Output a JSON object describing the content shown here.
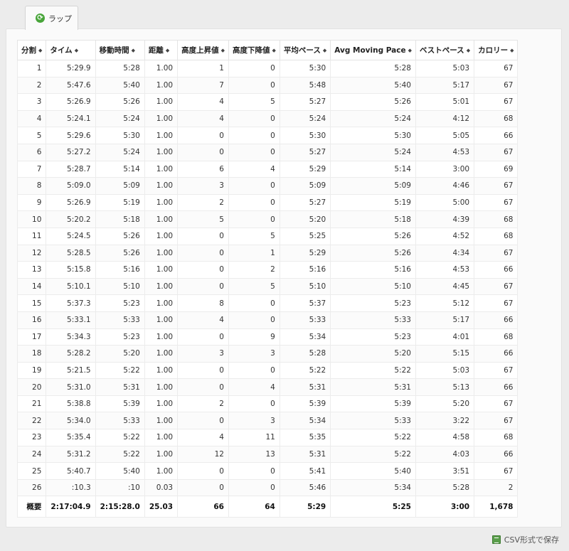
{
  "tab": {
    "label": "ラップ",
    "icon": "refresh-icon"
  },
  "columns": [
    "分割",
    "タイム",
    "移動時間",
    "距離",
    "高度上昇値",
    "高度下降値",
    "平均ペース",
    "Avg Moving Pace",
    "ベストペース",
    "カロリー"
  ],
  "rows": [
    [
      "1",
      "5:29.9",
      "5:28",
      "1.00",
      "1",
      "0",
      "5:30",
      "5:28",
      "5:03",
      "67"
    ],
    [
      "2",
      "5:47.6",
      "5:40",
      "1.00",
      "7",
      "0",
      "5:48",
      "5:40",
      "5:17",
      "67"
    ],
    [
      "3",
      "5:26.9",
      "5:26",
      "1.00",
      "4",
      "5",
      "5:27",
      "5:26",
      "5:01",
      "67"
    ],
    [
      "4",
      "5:24.1",
      "5:24",
      "1.00",
      "4",
      "0",
      "5:24",
      "5:24",
      "4:12",
      "68"
    ],
    [
      "5",
      "5:29.6",
      "5:30",
      "1.00",
      "0",
      "0",
      "5:30",
      "5:30",
      "5:05",
      "66"
    ],
    [
      "6",
      "5:27.2",
      "5:24",
      "1.00",
      "0",
      "0",
      "5:27",
      "5:24",
      "4:53",
      "67"
    ],
    [
      "7",
      "5:28.7",
      "5:14",
      "1.00",
      "6",
      "4",
      "5:29",
      "5:14",
      "3:00",
      "69"
    ],
    [
      "8",
      "5:09.0",
      "5:09",
      "1.00",
      "3",
      "0",
      "5:09",
      "5:09",
      "4:46",
      "67"
    ],
    [
      "9",
      "5:26.9",
      "5:19",
      "1.00",
      "2",
      "0",
      "5:27",
      "5:19",
      "5:00",
      "67"
    ],
    [
      "10",
      "5:20.2",
      "5:18",
      "1.00",
      "5",
      "0",
      "5:20",
      "5:18",
      "4:39",
      "68"
    ],
    [
      "11",
      "5:24.5",
      "5:26",
      "1.00",
      "0",
      "5",
      "5:25",
      "5:26",
      "4:52",
      "68"
    ],
    [
      "12",
      "5:28.5",
      "5:26",
      "1.00",
      "0",
      "1",
      "5:29",
      "5:26",
      "4:34",
      "67"
    ],
    [
      "13",
      "5:15.8",
      "5:16",
      "1.00",
      "0",
      "2",
      "5:16",
      "5:16",
      "4:53",
      "66"
    ],
    [
      "14",
      "5:10.1",
      "5:10",
      "1.00",
      "0",
      "5",
      "5:10",
      "5:10",
      "4:45",
      "67"
    ],
    [
      "15",
      "5:37.3",
      "5:23",
      "1.00",
      "8",
      "0",
      "5:37",
      "5:23",
      "5:12",
      "67"
    ],
    [
      "16",
      "5:33.1",
      "5:33",
      "1.00",
      "4",
      "0",
      "5:33",
      "5:33",
      "5:17",
      "66"
    ],
    [
      "17",
      "5:34.3",
      "5:23",
      "1.00",
      "0",
      "9",
      "5:34",
      "5:23",
      "4:01",
      "68"
    ],
    [
      "18",
      "5:28.2",
      "5:20",
      "1.00",
      "3",
      "3",
      "5:28",
      "5:20",
      "5:15",
      "66"
    ],
    [
      "19",
      "5:21.5",
      "5:22",
      "1.00",
      "0",
      "0",
      "5:22",
      "5:22",
      "5:03",
      "67"
    ],
    [
      "20",
      "5:31.0",
      "5:31",
      "1.00",
      "0",
      "4",
      "5:31",
      "5:31",
      "5:13",
      "66"
    ],
    [
      "21",
      "5:38.8",
      "5:39",
      "1.00",
      "2",
      "0",
      "5:39",
      "5:39",
      "5:20",
      "67"
    ],
    [
      "22",
      "5:34.0",
      "5:33",
      "1.00",
      "0",
      "3",
      "5:34",
      "5:33",
      "3:22",
      "67"
    ],
    [
      "23",
      "5:35.4",
      "5:22",
      "1.00",
      "4",
      "11",
      "5:35",
      "5:22",
      "4:58",
      "68"
    ],
    [
      "24",
      "5:31.2",
      "5:22",
      "1.00",
      "12",
      "13",
      "5:31",
      "5:22",
      "4:03",
      "66"
    ],
    [
      "25",
      "5:40.7",
      "5:40",
      "1.00",
      "0",
      "0",
      "5:41",
      "5:40",
      "3:51",
      "67"
    ],
    [
      "26",
      ":10.3",
      ":10",
      "0.03",
      "0",
      "0",
      "5:46",
      "5:34",
      "5:28",
      "2"
    ]
  ],
  "summary": [
    "概要",
    "2:17:04.9",
    "2:15:28.0",
    "25.03",
    "66",
    "64",
    "5:29",
    "5:25",
    "3:00",
    "1,678"
  ],
  "export": {
    "label": "CSV形式で保存",
    "icon": "spreadsheet-icon"
  }
}
